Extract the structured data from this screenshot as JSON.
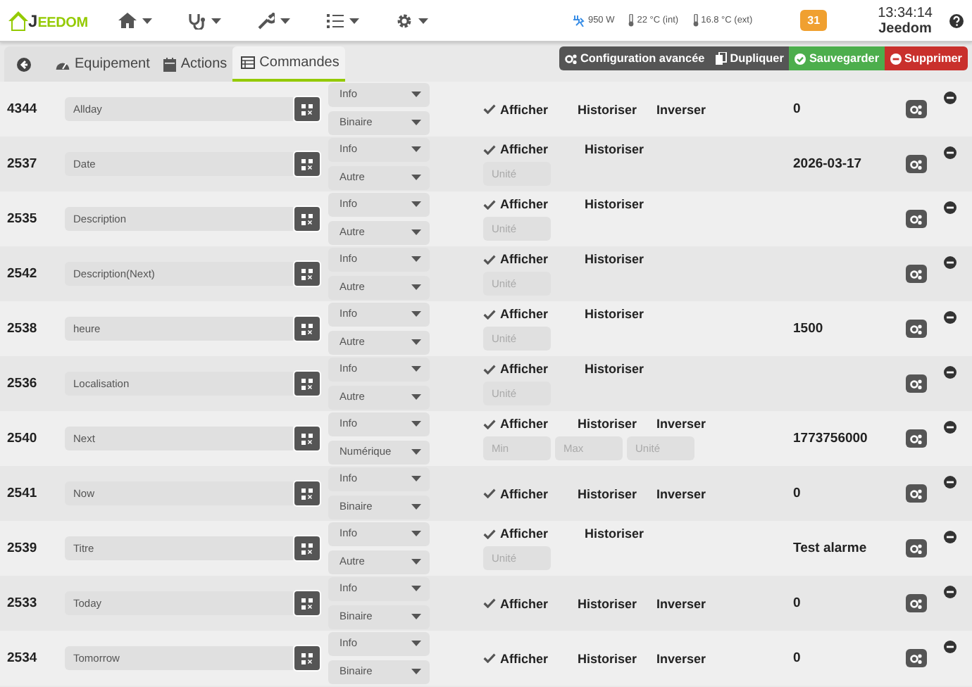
{
  "header": {
    "logo": {
      "initial": "J",
      "rest": "EEDOM"
    },
    "nav": [
      {
        "kind": "home"
      },
      {
        "kind": "health"
      },
      {
        "kind": "tools"
      },
      {
        "kind": "list"
      },
      {
        "kind": "settings"
      }
    ],
    "stats": [
      {
        "kind": "power",
        "text": "950 W"
      },
      {
        "kind": "temperature",
        "text": "22 °C (int)"
      },
      {
        "kind": "temperature",
        "text": "16.8 °C (ext)"
      }
    ],
    "badge": "31",
    "time": "13:34:14",
    "user": "Jeedom"
  },
  "tabs": [
    {
      "kind": "back",
      "selected": false
    },
    {
      "kind": "gauge",
      "label": "Equipement",
      "selected": false
    },
    {
      "kind": "calendar",
      "label": "Actions",
      "selected": false
    },
    {
      "kind": "table",
      "label": "Commandes",
      "selected": true
    }
  ],
  "actions": [
    {
      "kind": "advanced",
      "label": "Configuration avancée"
    },
    {
      "kind": "duplicate",
      "label": "Dupliquer"
    },
    {
      "kind": "save",
      "label": "Sauvegarder"
    },
    {
      "kind": "delete",
      "label": "Supprimer"
    }
  ],
  "commands": [
    {
      "id": "4344",
      "name": "Allday",
      "type": "Info",
      "subtype": "Binaire",
      "options": [
        {
          "label": "Afficher",
          "checked": true
        },
        {
          "label": "Historiser",
          "checked": false
        },
        {
          "label": "Inverser",
          "checked": false
        }
      ],
      "value": "0"
    },
    {
      "id": "2537",
      "name": "Date",
      "type": "Info",
      "subtype": "Autre",
      "options": [
        {
          "label": "Afficher",
          "checked": true
        },
        {
          "label": "Historiser",
          "checked": false
        }
      ],
      "fields": [
        {
          "placeholder": "Unité"
        }
      ],
      "value": "2026-03-17"
    },
    {
      "id": "2535",
      "name": "Description",
      "type": "Info",
      "subtype": "Autre",
      "options": [
        {
          "label": "Afficher",
          "checked": true
        },
        {
          "label": "Historiser",
          "checked": false
        }
      ],
      "fields": [
        {
          "placeholder": "Unité"
        }
      ]
    },
    {
      "id": "2542",
      "name": "Description(Next)",
      "type": "Info",
      "subtype": "Autre",
      "options": [
        {
          "label": "Afficher",
          "checked": true
        },
        {
          "label": "Historiser",
          "checked": false
        }
      ],
      "fields": [
        {
          "placeholder": "Unité"
        }
      ]
    },
    {
      "id": "2538",
      "name": "heure",
      "type": "Info",
      "subtype": "Autre",
      "options": [
        {
          "label": "Afficher",
          "checked": true
        },
        {
          "label": "Historiser",
          "checked": false
        }
      ],
      "fields": [
        {
          "placeholder": "Unité"
        }
      ],
      "value": "1500"
    },
    {
      "id": "2536",
      "name": "Localisation",
      "type": "Info",
      "subtype": "Autre",
      "options": [
        {
          "label": "Afficher",
          "checked": true
        },
        {
          "label": "Historiser",
          "checked": false
        }
      ],
      "fields": [
        {
          "placeholder": "Unité"
        }
      ]
    },
    {
      "id": "2540",
      "name": "Next",
      "type": "Info",
      "subtype": "Numérique",
      "options": [
        {
          "label": "Afficher",
          "checked": true
        },
        {
          "label": "Historiser",
          "checked": false
        },
        {
          "label": "Inverser",
          "checked": false
        }
      ],
      "fields": [
        {
          "placeholder": "Min"
        },
        {
          "placeholder": "Max"
        },
        {
          "placeholder": "Unité"
        }
      ],
      "value": "1773756000"
    },
    {
      "id": "2541",
      "name": "Now",
      "type": "Info",
      "subtype": "Binaire",
      "options": [
        {
          "label": "Afficher",
          "checked": true
        },
        {
          "label": "Historiser",
          "checked": false
        },
        {
          "label": "Inverser",
          "checked": false
        }
      ],
      "value": "0"
    },
    {
      "id": "2539",
      "name": "Titre",
      "type": "Info",
      "subtype": "Autre",
      "options": [
        {
          "label": "Afficher",
          "checked": true
        },
        {
          "label": "Historiser",
          "checked": false
        }
      ],
      "fields": [
        {
          "placeholder": "Unité"
        }
      ],
      "value": "Test alarme"
    },
    {
      "id": "2533",
      "name": "Today",
      "type": "Info",
      "subtype": "Binaire",
      "options": [
        {
          "label": "Afficher",
          "checked": true
        },
        {
          "label": "Historiser",
          "checked": false
        },
        {
          "label": "Inverser",
          "checked": false
        }
      ],
      "value": "0"
    },
    {
      "id": "2534",
      "name": "Tomorrow",
      "type": "Info",
      "subtype": "Binaire",
      "options": [
        {
          "label": "Afficher",
          "checked": true
        },
        {
          "label": "Historiser",
          "checked": false
        },
        {
          "label": "Inverser",
          "checked": false
        }
      ],
      "value": "0"
    }
  ]
}
